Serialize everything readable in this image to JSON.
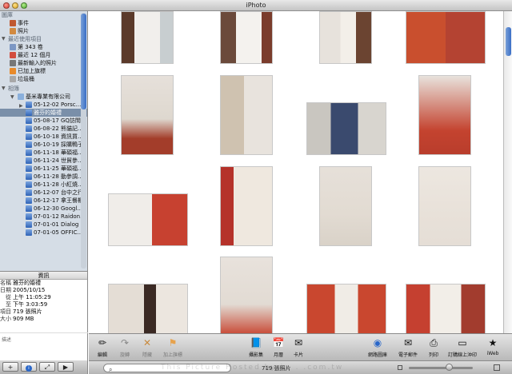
{
  "window": {
    "title": "iPhoto"
  },
  "sidebar": {
    "library_header": "圖庫",
    "library_items": [
      "事件",
      "照片"
    ],
    "recent_header": "最近使用項目",
    "recent_items": [
      "第 343 卷",
      "最近 12 個月",
      "最新輸入的照片",
      "已加上旗標",
      "垃圾桶"
    ],
    "albums_header": "相簿",
    "folder_label": "基米專業有限公司",
    "albums": [
      "05-12-02 Porsc...",
      "雅芬的婚禮",
      "05-08-17 GQ訪問",
      "06-08-22 熊貓記...",
      "06-10-18 資訊買...",
      "06-10-19 採購鴨子",
      "06-11-18 華碩福...",
      "06-11-24 世貿參...",
      "06-11-25 華碩福...",
      "06-11-28 動參調...",
      "06-11-28 小紅燒...",
      "06-12-07 台中之行",
      "06-12-17 拿王餐櫃",
      "06-12-30 Googl...",
      "07-01-12 Raidon...",
      "07-01-01 Dialog",
      "07-01-05 OFFIC..."
    ],
    "selected_album": "雅芬的婚禮"
  },
  "info": {
    "title": "資訊",
    "rows": [
      {
        "label": "名稱",
        "value": "雅芬的婚禮"
      },
      {
        "label": "日期",
        "value": "2005/10/15"
      },
      {
        "label": "從",
        "value": "上午 11:05:29"
      },
      {
        "label": "至",
        "value": "下午 3:03:59"
      },
      {
        "label": "項目",
        "value": "719 張照片"
      },
      {
        "label": "大小",
        "value": "909 MB"
      }
    ],
    "description_label": "描述"
  },
  "toolbar": {
    "edit": "編輯",
    "rotate": "旋轉",
    "hide": "隱藏",
    "flag": "加上旗標",
    "book": "攝影集",
    "calendar": "月曆",
    "card": "卡片",
    "web_gallery": "網路圖庫",
    "email": "電子郵件",
    "print": "列印",
    "order_prints": "訂購線上沖印",
    "iweb": "iWeb"
  },
  "status": {
    "watermark": "This Picture Hosted by j . . .com.tw",
    "count": "719 張照片"
  },
  "colors": {
    "sidebar_bg": "#d5dde6",
    "selection": "#7a8fa9",
    "accent_blue": "#3a6fc6"
  }
}
